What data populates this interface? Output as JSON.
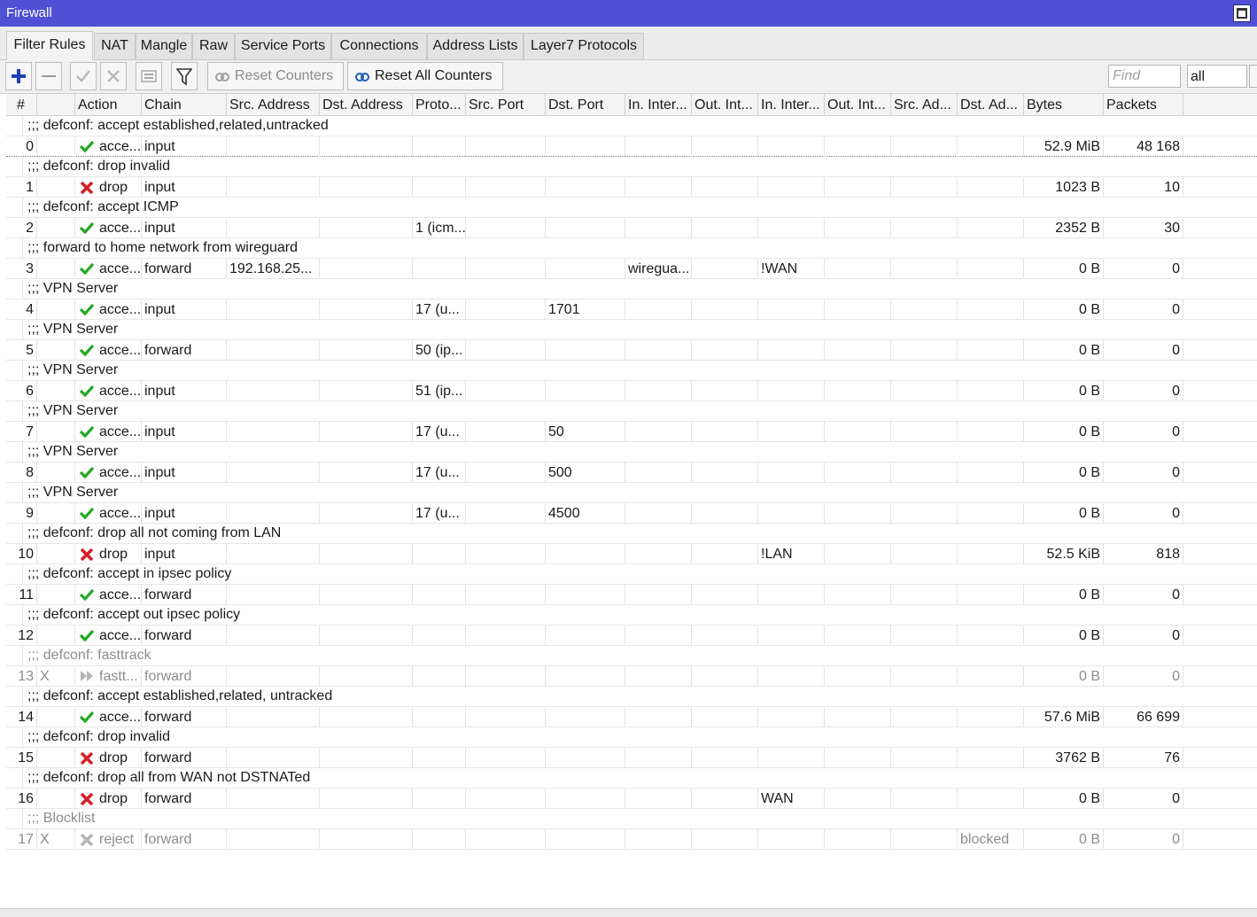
{
  "window": {
    "title": "Firewall"
  },
  "tabs": [
    {
      "label": "Filter Rules",
      "active": true
    },
    {
      "label": "NAT"
    },
    {
      "label": "Mangle"
    },
    {
      "label": "Raw"
    },
    {
      "label": "Service Ports"
    },
    {
      "label": "Connections"
    },
    {
      "label": "Address Lists"
    },
    {
      "label": "Layer7 Protocols"
    }
  ],
  "toolbar": {
    "reset_counters_label": "Reset Counters",
    "reset_all_counters_label": "Reset All Counters",
    "find_placeholder": "Find",
    "filter_value": "all"
  },
  "table": {
    "columns": [
      "#",
      "",
      "Action",
      "Chain",
      "Src. Address",
      "Dst. Address",
      "Proto...",
      "Src. Port",
      "Dst. Port",
      "In. Inter...",
      "Out. Int...",
      "In. Inter...",
      "Out. Int...",
      "Src. Ad...",
      "Dst. Ad...",
      "Bytes",
      "Packets"
    ],
    "rows": [
      {
        "comment": ";;; defconf: accept established,related,untracked",
        "index": "0",
        "flag": "",
        "action": "acce...",
        "action_icon": "accept-icon",
        "chain": "input",
        "src_address": "",
        "protocol": "",
        "dst_port": "",
        "in_interface": "",
        "in_interface_list": "",
        "dst_address_list": "",
        "bytes": "52.9 MiB",
        "packets": "48 168",
        "disabled": false
      },
      {
        "comment": ";;; defconf: drop invalid",
        "index": "1",
        "flag": "",
        "action": "drop",
        "action_icon": "drop-icon",
        "chain": "input",
        "src_address": "",
        "protocol": "",
        "dst_port": "",
        "in_interface": "",
        "in_interface_list": "",
        "dst_address_list": "",
        "bytes": "1023 B",
        "packets": "10",
        "disabled": false
      },
      {
        "comment": ";;; defconf: accept ICMP",
        "index": "2",
        "flag": "",
        "action": "acce...",
        "action_icon": "accept-icon",
        "chain": "input",
        "src_address": "",
        "protocol": "1 (icm...",
        "dst_port": "",
        "in_interface": "",
        "in_interface_list": "",
        "dst_address_list": "",
        "bytes": "2352 B",
        "packets": "30",
        "disabled": false
      },
      {
        "comment": ";;; forward to home network from wireguard",
        "index": "3",
        "flag": "",
        "action": "acce...",
        "action_icon": "accept-icon",
        "chain": "forward",
        "src_address": "192.168.25...",
        "protocol": "",
        "dst_port": "",
        "in_interface": "wiregua...",
        "in_interface_list": "!WAN",
        "dst_address_list": "",
        "bytes": "0 B",
        "packets": "0",
        "disabled": false
      },
      {
        "comment": ";;; VPN Server",
        "index": "4",
        "flag": "",
        "action": "acce...",
        "action_icon": "accept-icon",
        "chain": "input",
        "src_address": "",
        "protocol": "17 (u...",
        "dst_port": "1701",
        "in_interface": "",
        "in_interface_list": "",
        "dst_address_list": "",
        "bytes": "0 B",
        "packets": "0",
        "disabled": false
      },
      {
        "comment": ";;; VPN Server",
        "index": "5",
        "flag": "",
        "action": "acce...",
        "action_icon": "accept-icon",
        "chain": "forward",
        "src_address": "",
        "protocol": "50 (ip...",
        "dst_port": "",
        "in_interface": "",
        "in_interface_list": "",
        "dst_address_list": "",
        "bytes": "0 B",
        "packets": "0",
        "disabled": false
      },
      {
        "comment": ";;; VPN Server",
        "index": "6",
        "flag": "",
        "action": "acce...",
        "action_icon": "accept-icon",
        "chain": "input",
        "src_address": "",
        "protocol": "51 (ip...",
        "dst_port": "",
        "in_interface": "",
        "in_interface_list": "",
        "dst_address_list": "",
        "bytes": "0 B",
        "packets": "0",
        "disabled": false
      },
      {
        "comment": ";;; VPN Server",
        "index": "7",
        "flag": "",
        "action": "acce...",
        "action_icon": "accept-icon",
        "chain": "input",
        "src_address": "",
        "protocol": "17 (u...",
        "dst_port": "50",
        "in_interface": "",
        "in_interface_list": "",
        "dst_address_list": "",
        "bytes": "0 B",
        "packets": "0",
        "disabled": false
      },
      {
        "comment": ";;; VPN Server",
        "index": "8",
        "flag": "",
        "action": "acce...",
        "action_icon": "accept-icon",
        "chain": "input",
        "src_address": "",
        "protocol": "17 (u...",
        "dst_port": "500",
        "in_interface": "",
        "in_interface_list": "",
        "dst_address_list": "",
        "bytes": "0 B",
        "packets": "0",
        "disabled": false
      },
      {
        "comment": ";;; VPN Server",
        "index": "9",
        "flag": "",
        "action": "acce...",
        "action_icon": "accept-icon",
        "chain": "input",
        "src_address": "",
        "protocol": "17 (u...",
        "dst_port": "4500",
        "in_interface": "",
        "in_interface_list": "",
        "dst_address_list": "",
        "bytes": "0 B",
        "packets": "0",
        "disabled": false
      },
      {
        "comment": ";;; defconf: drop all not coming from LAN",
        "index": "10",
        "flag": "",
        "action": "drop",
        "action_icon": "drop-icon",
        "chain": "input",
        "src_address": "",
        "protocol": "",
        "dst_port": "",
        "in_interface": "",
        "in_interface_list": "!LAN",
        "dst_address_list": "",
        "bytes": "52.5 KiB",
        "packets": "818",
        "disabled": false
      },
      {
        "comment": ";;; defconf: accept in ipsec policy",
        "index": "11",
        "flag": "",
        "action": "acce...",
        "action_icon": "accept-icon",
        "chain": "forward",
        "src_address": "",
        "protocol": "",
        "dst_port": "",
        "in_interface": "",
        "in_interface_list": "",
        "dst_address_list": "",
        "bytes": "0 B",
        "packets": "0",
        "disabled": false
      },
      {
        "comment": ";;; defconf: accept out ipsec policy",
        "index": "12",
        "flag": "",
        "action": "acce...",
        "action_icon": "accept-icon",
        "chain": "forward",
        "src_address": "",
        "protocol": "",
        "dst_port": "",
        "in_interface": "",
        "in_interface_list": "",
        "dst_address_list": "",
        "bytes": "0 B",
        "packets": "0",
        "disabled": false
      },
      {
        "comment": ";;; defconf: fasttrack",
        "index": "13",
        "flag": "X",
        "action": "fastt...",
        "action_icon": "fasttrack-icon",
        "chain": "forward",
        "src_address": "",
        "protocol": "",
        "dst_port": "",
        "in_interface": "",
        "in_interface_list": "",
        "dst_address_list": "",
        "bytes": "0 B",
        "packets": "0",
        "disabled": true
      },
      {
        "comment": ";;; defconf: accept established,related, untracked",
        "index": "14",
        "flag": "",
        "action": "acce...",
        "action_icon": "accept-icon",
        "chain": "forward",
        "src_address": "",
        "protocol": "",
        "dst_port": "",
        "in_interface": "",
        "in_interface_list": "",
        "dst_address_list": "",
        "bytes": "57.6 MiB",
        "packets": "66 699",
        "disabled": false
      },
      {
        "comment": ";;; defconf: drop invalid",
        "index": "15",
        "flag": "",
        "action": "drop",
        "action_icon": "drop-icon",
        "chain": "forward",
        "src_address": "",
        "protocol": "",
        "dst_port": "",
        "in_interface": "",
        "in_interface_list": "",
        "dst_address_list": "",
        "bytes": "3762 B",
        "packets": "76",
        "disabled": false
      },
      {
        "comment": ";;; defconf:  drop all from WAN not DSTNATed",
        "index": "16",
        "flag": "",
        "action": "drop",
        "action_icon": "drop-icon",
        "chain": "forward",
        "src_address": "",
        "protocol": "",
        "dst_port": "",
        "in_interface": "",
        "in_interface_list": "WAN",
        "dst_address_list": "",
        "bytes": "0 B",
        "packets": "0",
        "disabled": false
      },
      {
        "comment": ";;; Blocklist",
        "index": "17",
        "flag": "X",
        "action": "reject",
        "action_icon": "reject-icon",
        "chain": "forward",
        "src_address": "",
        "protocol": "",
        "dst_port": "",
        "in_interface": "",
        "in_interface_list": "",
        "dst_address_list": "blocked",
        "bytes": "0 B",
        "packets": "0",
        "disabled": true
      }
    ]
  },
  "colors": {
    "titlebar": "#5050d6",
    "accept": "#22a822",
    "drop": "#d4202a",
    "disabled_text": "#8c8c8c",
    "add_button": "#1f3fb5"
  }
}
